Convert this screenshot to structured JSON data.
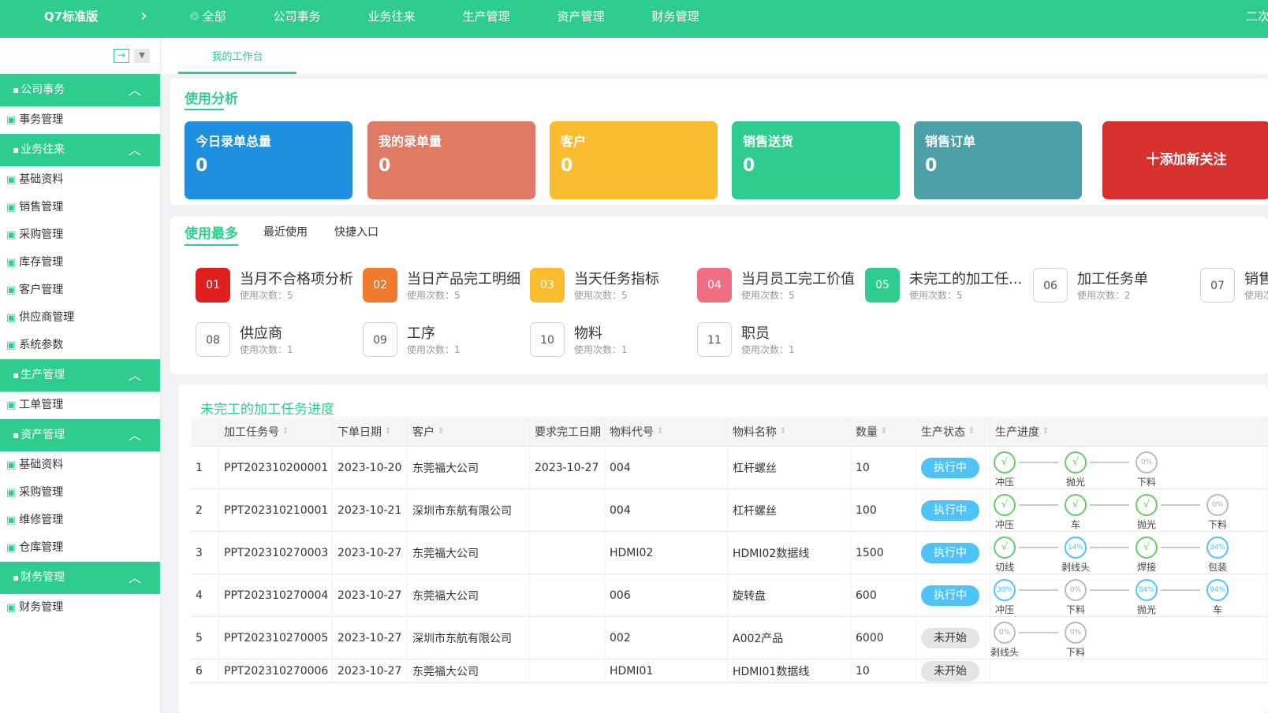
{
  "app": {
    "brand": "Q7标准版",
    "top_right": "二次开发"
  },
  "topnav": [
    {
      "icon": "grid-icon",
      "label": "全部"
    },
    {
      "label": "公司事务"
    },
    {
      "label": "业务往来"
    },
    {
      "label": "生产管理"
    },
    {
      "label": "资产管理"
    },
    {
      "label": "财务管理"
    }
  ],
  "sidebar": {
    "groups": [
      {
        "title": "公司事务",
        "items": [
          "事务管理"
        ]
      },
      {
        "title": "业务往来",
        "items": [
          "基础资料",
          "销售管理",
          "采购管理",
          "库存管理",
          "客户管理",
          "供应商管理",
          "系统参数"
        ]
      },
      {
        "title": "生产管理",
        "items": [
          "工单管理"
        ]
      },
      {
        "title": "资产管理",
        "items": [
          "基础资料",
          "采购管理",
          "维修管理",
          "仓库管理"
        ]
      },
      {
        "title": "财务管理",
        "items": [
          "财务管理"
        ]
      }
    ]
  },
  "tab": {
    "label": "我的工作台"
  },
  "usage": {
    "title": "使用分析",
    "cards": [
      {
        "title": "今日录单总量",
        "value": "0",
        "color": "#1e90e0"
      },
      {
        "title": "我的录单量",
        "value": "0",
        "color": "#e07a64"
      },
      {
        "title": "客户",
        "value": "0",
        "color": "#fbbd2e"
      },
      {
        "title": "销售送货",
        "value": "0",
        "color": "#2ecc8f"
      },
      {
        "title": "销售订单",
        "value": "0",
        "color": "#4ca0a8"
      }
    ],
    "add_label": "十添加新关注"
  },
  "most_used": {
    "tabs": [
      "使用最多",
      "最近使用",
      "快捷入口"
    ],
    "items": [
      {
        "no": "01",
        "name": "当月不合格项分析",
        "sub": "使用次数：5",
        "color": "#e02020"
      },
      {
        "no": "02",
        "name": "当日产品完工明细",
        "sub": "使用次数：5",
        "color": "#f07a2e"
      },
      {
        "no": "03",
        "name": "当天任务指标",
        "sub": "使用次数：5",
        "color": "#fbbd2e"
      },
      {
        "no": "04",
        "name": "当月员工完工价值",
        "sub": "使用次数：5",
        "color": "#ef6f82"
      },
      {
        "no": "05",
        "name": "未完工的加工任...",
        "sub": "使用次数：5",
        "color": "#2ecc8f"
      },
      {
        "no": "06",
        "name": "加工任务单",
        "sub": "使用次数：2",
        "color": ""
      },
      {
        "no": "07",
        "name": "销售",
        "sub": "使用次",
        "color": ""
      },
      {
        "no": "08",
        "name": "供应商",
        "sub": "使用次数：1",
        "color": ""
      },
      {
        "no": "09",
        "name": "工序",
        "sub": "使用次数：1",
        "color": ""
      },
      {
        "no": "10",
        "name": "物料",
        "sub": "使用次数：1",
        "color": ""
      },
      {
        "no": "11",
        "name": "职员",
        "sub": "使用次数：1",
        "color": ""
      }
    ]
  },
  "tasks": {
    "title": "未完工的加工任务进度",
    "columns": [
      "",
      "加工任务号",
      "下单日期",
      "客户",
      "要求完工日期",
      "物料代号",
      "物料名称",
      "数量",
      "生产状态",
      "生产进度"
    ],
    "rows": [
      {
        "idx": "1",
        "task": "PPT202310200001",
        "date": "2023-10-20",
        "customer": "东莞福大公司",
        "due": "2023-10-27",
        "code": "004",
        "name": "杠杆螺丝",
        "qty": "10",
        "status": "执行中",
        "steps": [
          {
            "mark": "√",
            "label": "冲压"
          },
          {
            "mark": "√",
            "label": "抛光"
          },
          {
            "mark": "0%",
            "label": "下料"
          }
        ]
      },
      {
        "idx": "2",
        "task": "PPT202310210001",
        "date": "2023-10-21",
        "customer": "深圳市东航有限公司",
        "due": "",
        "code": "004",
        "name": "杠杆螺丝",
        "qty": "100",
        "status": "执行中",
        "steps": [
          {
            "mark": "√",
            "label": "冲压"
          },
          {
            "mark": "√",
            "label": "车"
          },
          {
            "mark": "√",
            "label": "抛光"
          },
          {
            "mark": "0%",
            "label": "下料"
          }
        ]
      },
      {
        "idx": "3",
        "task": "PPT202310270003",
        "date": "2023-10-27",
        "customer": "东莞福大公司",
        "due": "",
        "code": "HDMI02",
        "name": "HDMI02数据线",
        "qty": "1500",
        "status": "执行中",
        "steps": [
          {
            "mark": "√",
            "label": "切线"
          },
          {
            "mark": "14%",
            "label": "剥线头"
          },
          {
            "mark": "√",
            "label": "焊接"
          },
          {
            "mark": "34%",
            "label": "包装"
          }
        ]
      },
      {
        "idx": "4",
        "task": "PPT202310270004",
        "date": "2023-10-27",
        "customer": "东莞福大公司",
        "due": "",
        "code": "006",
        "name": "旋转盘",
        "qty": "600",
        "status": "执行中",
        "steps": [
          {
            "mark": "30%",
            "label": "冲压"
          },
          {
            "mark": "0%",
            "label": "下料"
          },
          {
            "mark": "84%",
            "label": "抛光"
          },
          {
            "mark": "94%",
            "label": "车"
          }
        ]
      },
      {
        "idx": "5",
        "task": "PPT202310270005",
        "date": "2023-10-27",
        "customer": "深圳市东航有限公司",
        "due": "",
        "code": "002",
        "name": "A002产品",
        "qty": "6000",
        "status": "未开始",
        "steps": [
          {
            "mark": "0%",
            "label": "剥线头"
          },
          {
            "mark": "0%",
            "label": "下料"
          }
        ]
      },
      {
        "idx": "6",
        "task": "PPT202310270006",
        "date": "2023-10-27",
        "customer": "东莞福大公司",
        "due": "",
        "code": "HDMI01",
        "name": "HDMI01数据线",
        "qty": "10",
        "status": "未开始",
        "steps": []
      }
    ]
  }
}
